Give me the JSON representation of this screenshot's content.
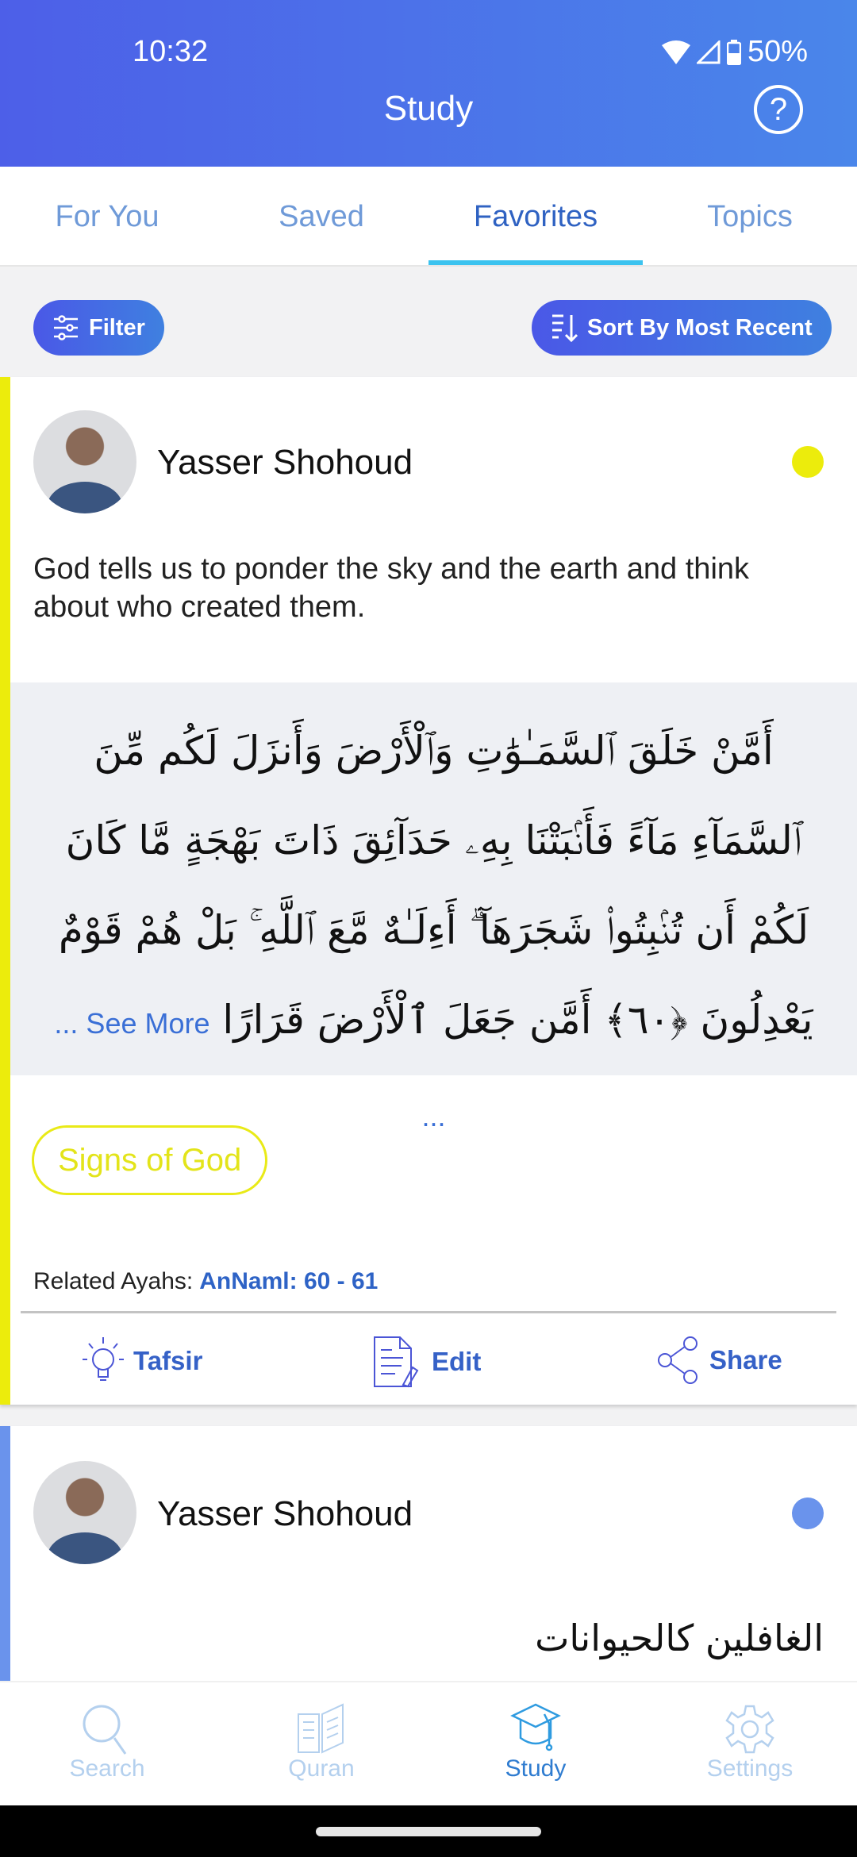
{
  "status_bar": {
    "time": "10:32",
    "battery": "50%"
  },
  "header": {
    "title": "Study",
    "help_icon": "?"
  },
  "tabs": [
    {
      "label": "For You"
    },
    {
      "label": "Saved"
    },
    {
      "label": "Favorites",
      "active": true
    },
    {
      "label": "Topics"
    }
  ],
  "toolbar": {
    "filter_label": "Filter",
    "sort_label": "Sort By Most Recent"
  },
  "cards": [
    {
      "author": "Yasser Shohoud",
      "color": "#ecec0c",
      "description": "God tells us to ponder the sky and the earth and think about who created them.",
      "arabic": "أَمَّنْ خَلَقَ ٱلسَّمَـٰوَٰتِ وَٱلْأَرْضَ وَأَنزَلَ لَكُم مِّنَ ٱلسَّمَآءِ مَآءً فَأَنۢبَتْنَا بِهِۦ حَدَآئِقَ ذَاتَ بَهْجَةٍ مَّا كَانَ لَكُمْ أَن تُنۢبِتُوا۟ شَجَرَهَآ ۗ أَءِلَـٰهٌ مَّعَ ٱللَّهِ ۚ بَلْ هُمْ قَوْمٌ يَعْدِلُونَ ﴿٦٠﴾ أَمَّن جَعَلَ ٱلْأَرْضَ قَرَارًا",
      "see_more": "... See More ...",
      "tag": "Signs of God",
      "related_label": "Related Ayahs:",
      "related_value": "AnNaml: 60 - 61",
      "actions": {
        "tafsir": "Tafsir",
        "edit": "Edit",
        "share": "Share"
      }
    },
    {
      "author": "Yasser Shohoud",
      "color": "#6a93ec",
      "arabic": "الغافلين كالحيوانات"
    }
  ],
  "bottom_nav": [
    {
      "label": "Search"
    },
    {
      "label": "Quran"
    },
    {
      "label": "Study",
      "active": true
    },
    {
      "label": "Settings"
    }
  ]
}
